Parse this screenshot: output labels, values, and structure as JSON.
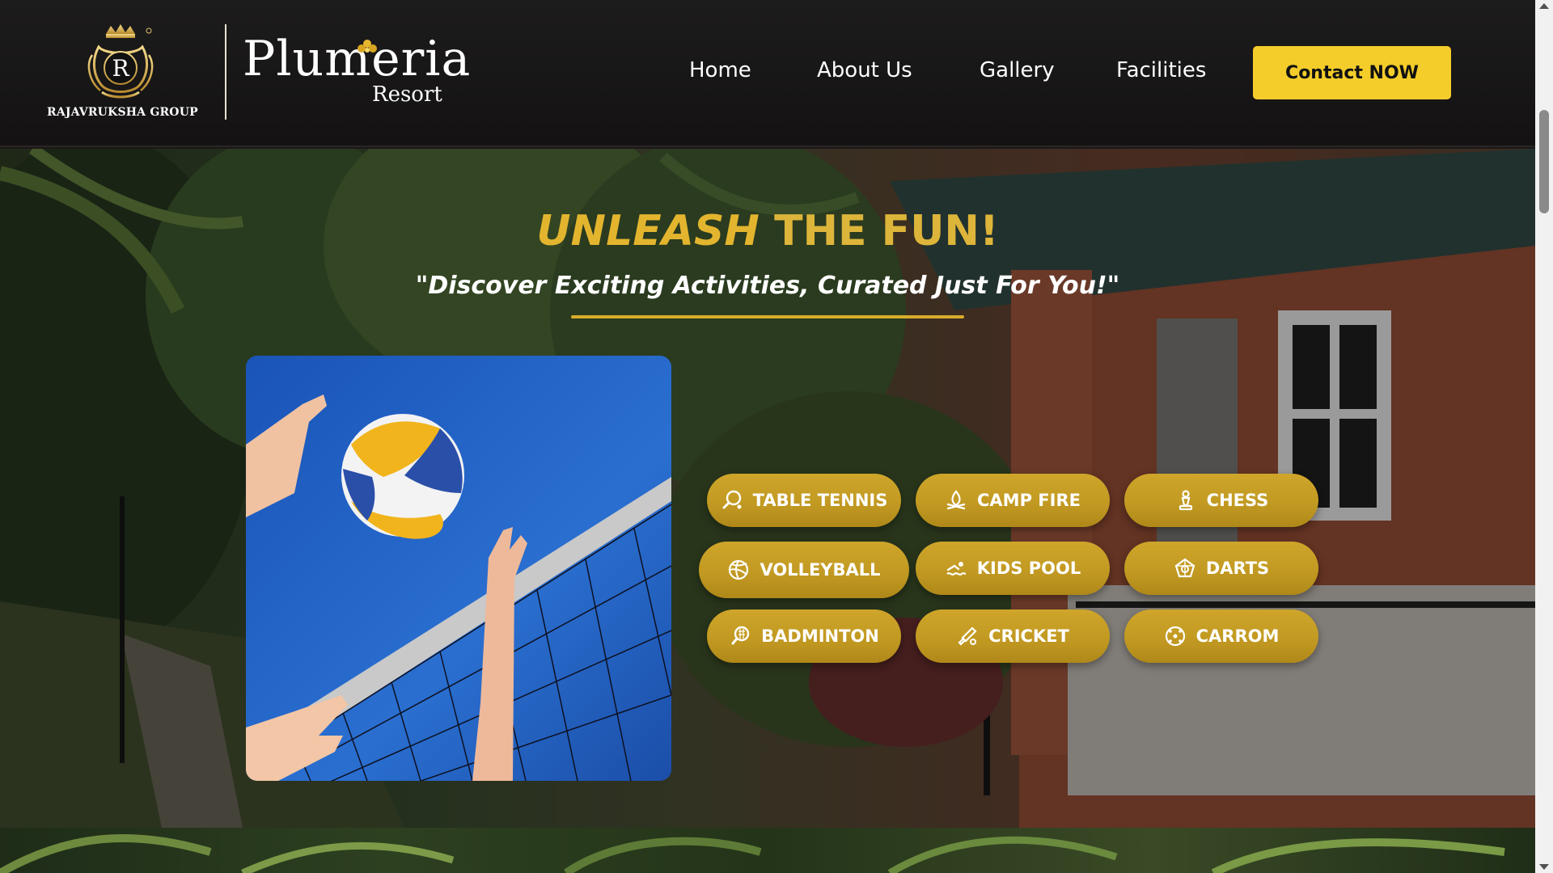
{
  "header": {
    "group_name": "RAJAVRUKSHA GROUP",
    "crest_letter": "R",
    "resort_name": "Plumeria",
    "resort_subtitle": "Resort",
    "nav": [
      {
        "label": "Home"
      },
      {
        "label": "About Us"
      },
      {
        "label": "Gallery"
      },
      {
        "label": "Facilities"
      }
    ],
    "cta_label": "Contact NOW"
  },
  "hero": {
    "title_accent": "UNLEASH",
    "title_rest": "THE FUN!",
    "subtitle": "\"Discover Exciting Activities, Curated Just For You!\"",
    "activities": [
      {
        "label": "TABLE TENNIS",
        "icon": "table-tennis-icon"
      },
      {
        "label": "CAMP FIRE",
        "icon": "campfire-icon"
      },
      {
        "label": "CHESS",
        "icon": "chess-icon"
      },
      {
        "label": "VOLLEYBALL",
        "icon": "volleyball-icon"
      },
      {
        "label": "KIDS POOL",
        "icon": "swimmer-icon"
      },
      {
        "label": "DARTS",
        "icon": "dartboard-icon"
      },
      {
        "label": "BADMINTON",
        "icon": "shuttlecock-icon"
      },
      {
        "label": "CRICKET",
        "icon": "cricket-bat-icon"
      },
      {
        "label": "CARROM",
        "icon": "carrom-icon"
      }
    ]
  },
  "colors": {
    "accent_gold": "#f4cd2a",
    "button_gold": "#c7a024",
    "title_gold": "#ddb53a",
    "header_bg": "#171515"
  }
}
